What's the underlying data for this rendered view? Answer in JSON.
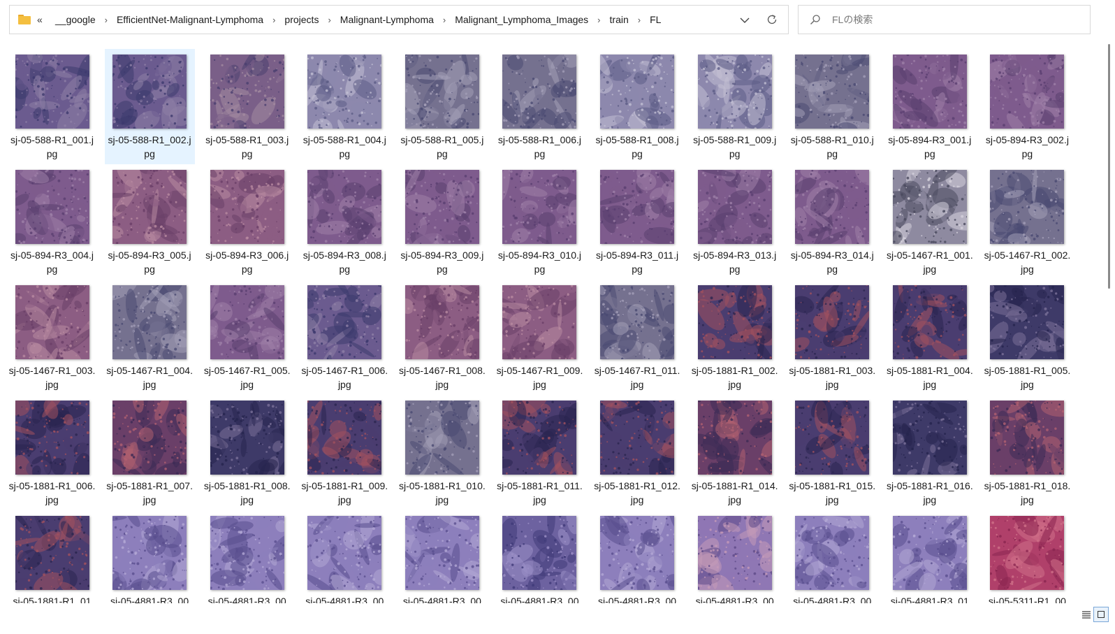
{
  "address_bar": {
    "overflow": "«",
    "breadcrumbs": [
      "__google",
      "EfficientNet-Malignant-Lymphoma",
      "projects",
      "Malignant-Lymphoma",
      "Malignant_Lymphoma_Images",
      "train",
      "FL"
    ],
    "separator": "›"
  },
  "search": {
    "placeholder": "FLの検索"
  },
  "files": [
    {
      "name": "sj-05-588-R1_001.jpg",
      "tone": "dark-violet"
    },
    {
      "name": "sj-05-588-R1_002.jpg",
      "tone": "dark-violet",
      "selected": true
    },
    {
      "name": "sj-05-588-R1_003.jpg",
      "tone": "violet-pink"
    },
    {
      "name": "sj-05-588-R1_004.jpg",
      "tone": "pale-violet"
    },
    {
      "name": "sj-05-588-R1_005.jpg",
      "tone": "grey-violet"
    },
    {
      "name": "sj-05-588-R1_006.jpg",
      "tone": "grey-violet"
    },
    {
      "name": "sj-05-588-R1_008.jpg",
      "tone": "pale-violet"
    },
    {
      "name": "sj-05-588-R1_009.jpg",
      "tone": "pale-violet"
    },
    {
      "name": "sj-05-588-R1_010.jpg",
      "tone": "grey-violet"
    },
    {
      "name": "sj-05-894-R3_001.jpg",
      "tone": "mauve"
    },
    {
      "name": "sj-05-894-R3_002.jpg",
      "tone": "mauve"
    },
    {
      "name": "sj-05-894-R3_004.jpg",
      "tone": "mauve"
    },
    {
      "name": "sj-05-894-R3_005.jpg",
      "tone": "mauve-pink"
    },
    {
      "name": "sj-05-894-R3_006.jpg",
      "tone": "mauve-pink"
    },
    {
      "name": "sj-05-894-R3_008.jpg",
      "tone": "mauve"
    },
    {
      "name": "sj-05-894-R3_009.jpg",
      "tone": "mauve"
    },
    {
      "name": "sj-05-894-R3_010.jpg",
      "tone": "mauve"
    },
    {
      "name": "sj-05-894-R3_011.jpg",
      "tone": "mauve"
    },
    {
      "name": "sj-05-894-R3_013.jpg",
      "tone": "mauve"
    },
    {
      "name": "sj-05-894-R3_014.jpg",
      "tone": "mauve"
    },
    {
      "name": "sj-05-1467-R1_001.jpg",
      "tone": "grey-pale"
    },
    {
      "name": "sj-05-1467-R1_002.jpg",
      "tone": "grey-violet"
    },
    {
      "name": "sj-05-1467-R1_003.jpg",
      "tone": "mauve-pink"
    },
    {
      "name": "sj-05-1467-R1_004.jpg",
      "tone": "grey-violet"
    },
    {
      "name": "sj-05-1467-R1_005.jpg",
      "tone": "mauve"
    },
    {
      "name": "sj-05-1467-R1_006.jpg",
      "tone": "dark-violet"
    },
    {
      "name": "sj-05-1467-R1_008.jpg",
      "tone": "mauve-pink"
    },
    {
      "name": "sj-05-1467-R1_009.jpg",
      "tone": "mauve-pink"
    },
    {
      "name": "sj-05-1467-R1_011.jpg",
      "tone": "grey-violet"
    },
    {
      "name": "sj-05-1881-R1_002.jpg",
      "tone": "navy-red"
    },
    {
      "name": "sj-05-1881-R1_003.jpg",
      "tone": "navy-red"
    },
    {
      "name": "sj-05-1881-R1_004.jpg",
      "tone": "navy-red"
    },
    {
      "name": "sj-05-1881-R1_005.jpg",
      "tone": "navy"
    },
    {
      "name": "sj-05-1881-R1_006.jpg",
      "tone": "navy-red"
    },
    {
      "name": "sj-05-1881-R1_007.jpg",
      "tone": "red-violet"
    },
    {
      "name": "sj-05-1881-R1_008.jpg",
      "tone": "navy"
    },
    {
      "name": "sj-05-1881-R1_009.jpg",
      "tone": "navy-red"
    },
    {
      "name": "sj-05-1881-R1_010.jpg",
      "tone": "grey-violet"
    },
    {
      "name": "sj-05-1881-R1_011.jpg",
      "tone": "navy-red"
    },
    {
      "name": "sj-05-1881-R1_012.jpg",
      "tone": "navy-red"
    },
    {
      "name": "sj-05-1881-R1_014.jpg",
      "tone": "red-violet"
    },
    {
      "name": "sj-05-1881-R1_015.jpg",
      "tone": "navy-red"
    },
    {
      "name": "sj-05-1881-R1_016.jpg",
      "tone": "navy"
    },
    {
      "name": "sj-05-1881-R1_018.jpg",
      "tone": "red-violet"
    },
    {
      "name": "sj-05-1881-R1_01",
      "tone": "navy-red"
    },
    {
      "name": "sj-05-4881-R3_00",
      "tone": "lilac"
    },
    {
      "name": "sj-05-4881-R3_00",
      "tone": "lilac"
    },
    {
      "name": "sj-05-4881-R3_00",
      "tone": "lilac"
    },
    {
      "name": "sj-05-4881-R3_00",
      "tone": "lilac"
    },
    {
      "name": "sj-05-4881-R3_00",
      "tone": "lilac-dark"
    },
    {
      "name": "sj-05-4881-R3_00",
      "tone": "lilac"
    },
    {
      "name": "sj-05-4881-R3_00",
      "tone": "lilac-pink"
    },
    {
      "name": "sj-05-4881-R3_00",
      "tone": "lilac"
    },
    {
      "name": "sj-05-4881-R3_01",
      "tone": "lilac"
    },
    {
      "name": "sj-05-5311-R1_00",
      "tone": "magenta"
    }
  ],
  "tones": {
    "dark-violet": [
      "#3d3a6e",
      "#6b5b8f",
      "#8e7fa6"
    ],
    "violet-pink": [
      "#4a3f6f",
      "#7a5f88",
      "#a38aa0"
    ],
    "pale-violet": [
      "#5d5c86",
      "#8d88ad",
      "#c2bfd3"
    ],
    "grey-violet": [
      "#4a4a72",
      "#75718f",
      "#a29eb6"
    ],
    "mauve": [
      "#5a3f70",
      "#7e5b8d",
      "#9e7fa8"
    ],
    "mauve-pink": [
      "#6a3f68",
      "#8c5d83",
      "#b88aa0"
    ],
    "grey-pale": [
      "#4a4a5e",
      "#8e8aa0",
      "#d6d2dc"
    ],
    "navy-red": [
      "#2a2550",
      "#4a3d70",
      "#a0505e"
    ],
    "navy": [
      "#26244e",
      "#3e3a68",
      "#7a7098"
    ],
    "red-violet": [
      "#3c2b55",
      "#6a3f68",
      "#b06070"
    ],
    "lilac": [
      "#5a4f8e",
      "#8d7fbc",
      "#b3a7d4"
    ],
    "lilac-dark": [
      "#3f3a78",
      "#6d62a0",
      "#9b8fc6"
    ],
    "lilac-pink": [
      "#5e4a88",
      "#8f77b4",
      "#c49ab8"
    ],
    "magenta": [
      "#8a2550",
      "#b0406a",
      "#cf7088"
    ]
  },
  "statusbar": {
    "view_details": "details-view-icon",
    "view_tiles": "large-icons-view-icon"
  }
}
